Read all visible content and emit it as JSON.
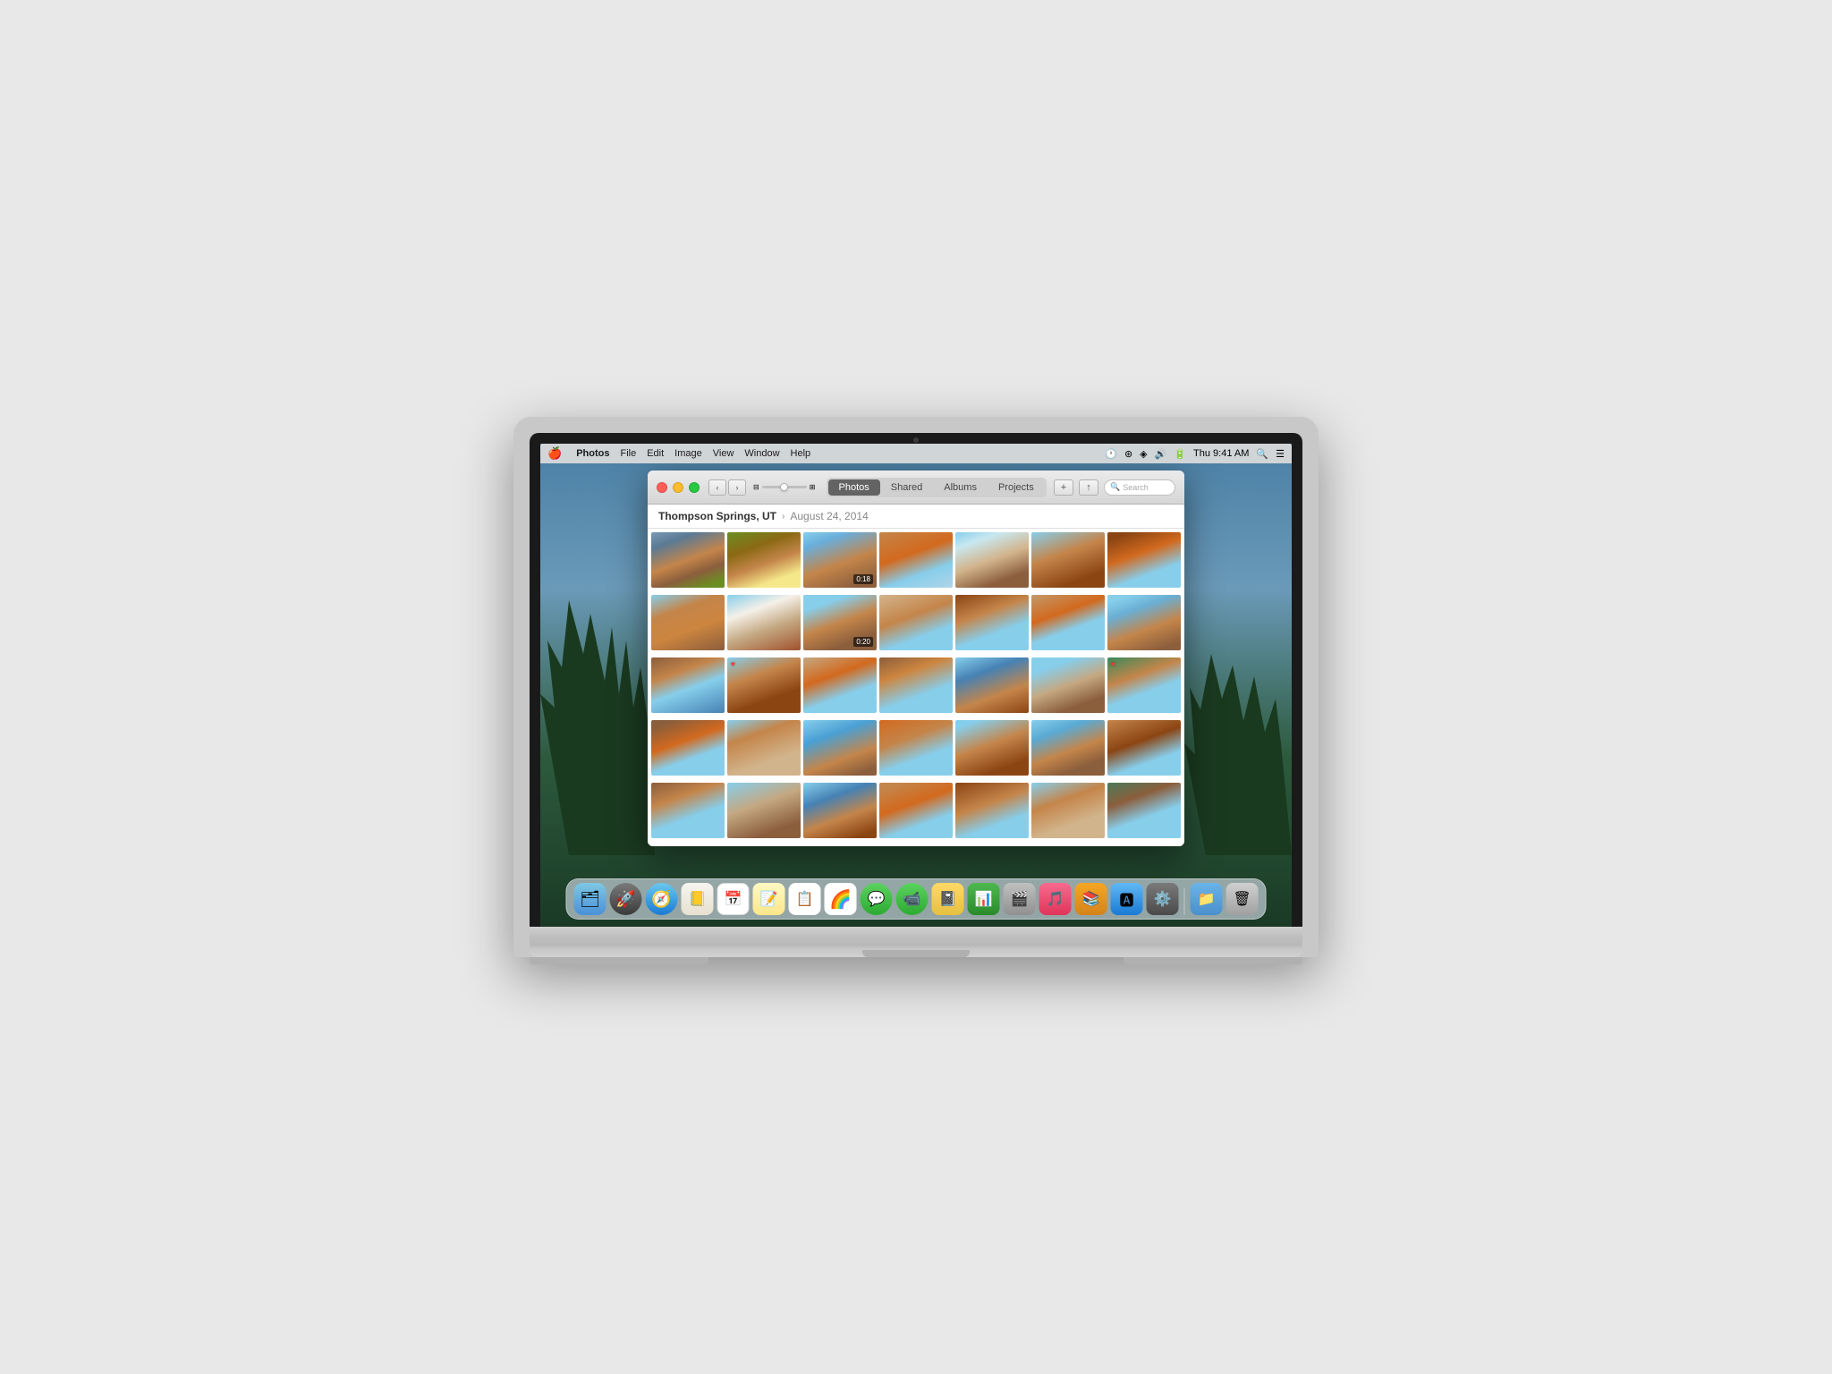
{
  "menubar": {
    "apple": "🍎",
    "app_name": "Photos",
    "menu_items": [
      "File",
      "Edit",
      "Image",
      "View",
      "Window",
      "Help"
    ],
    "time": "Thu 9:41 AM",
    "icons": [
      "clock",
      "bluetooth",
      "wifi",
      "sound",
      "battery"
    ]
  },
  "window": {
    "title": "Photos",
    "tabs": [
      {
        "label": "Photos",
        "active": true
      },
      {
        "label": "Shared",
        "active": false
      },
      {
        "label": "Albums",
        "active": false
      },
      {
        "label": "Projects",
        "active": false
      }
    ],
    "search_placeholder": "Search",
    "location": {
      "name": "Thompson Springs, UT",
      "separator": "›",
      "date": "August 24, 2014"
    }
  },
  "photos": {
    "grid": [
      {
        "id": 1,
        "has_video": false,
        "video_time": "",
        "has_heart": false
      },
      {
        "id": 2,
        "has_video": false,
        "video_time": "",
        "has_heart": false
      },
      {
        "id": 3,
        "has_video": true,
        "video_time": "0:18",
        "has_heart": false
      },
      {
        "id": 4,
        "has_video": false,
        "video_time": "",
        "has_heart": false
      },
      {
        "id": 5,
        "has_video": false,
        "video_time": "",
        "has_heart": false
      },
      {
        "id": 6,
        "has_video": false,
        "video_time": "",
        "has_heart": false
      },
      {
        "id": 7,
        "has_video": false,
        "video_time": "",
        "has_heart": false
      },
      {
        "id": 8,
        "has_video": false,
        "video_time": "",
        "has_heart": false
      },
      {
        "id": 9,
        "has_video": false,
        "video_time": "",
        "has_heart": false
      },
      {
        "id": 10,
        "has_video": true,
        "video_time": "0:20",
        "has_heart": false
      },
      {
        "id": 11,
        "has_video": false,
        "video_time": "",
        "has_heart": false
      },
      {
        "id": 12,
        "has_video": false,
        "video_time": "",
        "has_heart": false
      },
      {
        "id": 13,
        "has_video": false,
        "video_time": "",
        "has_heart": false
      },
      {
        "id": 14,
        "has_video": false,
        "video_time": "",
        "has_heart": false
      },
      {
        "id": 15,
        "has_video": false,
        "video_time": "",
        "has_heart": false
      },
      {
        "id": 16,
        "has_video": false,
        "video_time": "",
        "has_heart": true
      },
      {
        "id": 17,
        "has_video": false,
        "video_time": "",
        "has_heart": false
      },
      {
        "id": 18,
        "has_video": false,
        "video_time": "",
        "has_heart": false
      },
      {
        "id": 19,
        "has_video": false,
        "video_time": "",
        "has_heart": false
      },
      {
        "id": 20,
        "has_video": false,
        "video_time": "",
        "has_heart": false
      },
      {
        "id": 21,
        "has_video": false,
        "video_time": "",
        "has_heart": true
      },
      {
        "id": 22,
        "has_video": false,
        "video_time": "",
        "has_heart": false
      },
      {
        "id": 23,
        "has_video": false,
        "video_time": "",
        "has_heart": false
      },
      {
        "id": 24,
        "has_video": false,
        "video_time": "",
        "has_heart": false
      },
      {
        "id": 25,
        "has_video": false,
        "video_time": "",
        "has_heart": false
      },
      {
        "id": 26,
        "has_video": false,
        "video_time": "",
        "has_heart": false
      },
      {
        "id": 27,
        "has_video": false,
        "video_time": "",
        "has_heart": false
      },
      {
        "id": 28,
        "has_video": false,
        "video_time": "",
        "has_heart": false
      },
      {
        "id": 29,
        "has_video": false,
        "video_time": "",
        "has_heart": false
      },
      {
        "id": 30,
        "has_video": false,
        "video_time": "",
        "has_heart": false
      },
      {
        "id": 31,
        "has_video": false,
        "video_time": "",
        "has_heart": false
      },
      {
        "id": 32,
        "has_video": false,
        "video_time": "",
        "has_heart": false
      },
      {
        "id": 33,
        "has_video": false,
        "video_time": "",
        "has_heart": false
      },
      {
        "id": 34,
        "has_video": false,
        "video_time": "",
        "has_heart": false
      },
      {
        "id": 35,
        "has_video": false,
        "video_time": "",
        "has_heart": false
      }
    ]
  },
  "dock": {
    "apps": [
      {
        "name": "Finder",
        "icon": "🗂",
        "style": "finder"
      },
      {
        "name": "Launchpad",
        "icon": "🚀",
        "style": "launchpad"
      },
      {
        "name": "Safari",
        "icon": "🧭",
        "style": "safari"
      },
      {
        "name": "Contacts",
        "icon": "📒",
        "style": "contacts"
      },
      {
        "name": "Calendar",
        "icon": "📅",
        "style": "calendar"
      },
      {
        "name": "Notes",
        "icon": "📝",
        "style": "notes"
      },
      {
        "name": "Reminders",
        "icon": "📋",
        "style": "reminders"
      },
      {
        "name": "Photos",
        "icon": "🌈",
        "style": "photos"
      },
      {
        "name": "Messages",
        "icon": "💬",
        "style": "imessage"
      },
      {
        "name": "FaceTime",
        "icon": "📹",
        "style": "facetime"
      },
      {
        "name": "Notes2",
        "icon": "📓",
        "style": "notes2"
      },
      {
        "name": "Numbers",
        "icon": "📊",
        "style": "numbers"
      },
      {
        "name": "DVD",
        "icon": "🎬",
        "style": "dvd"
      },
      {
        "name": "iTunes",
        "icon": "🎵",
        "style": "itunes"
      },
      {
        "name": "iBooks",
        "icon": "📚",
        "style": "ibooks"
      },
      {
        "name": "App Store",
        "icon": "🅰",
        "style": "appstore"
      },
      {
        "name": "System Preferences",
        "icon": "⚙️",
        "style": "syspref"
      },
      {
        "name": "Folder",
        "icon": "📁",
        "style": "folder"
      },
      {
        "name": "Trash",
        "icon": "🗑",
        "style": "trash"
      }
    ]
  }
}
